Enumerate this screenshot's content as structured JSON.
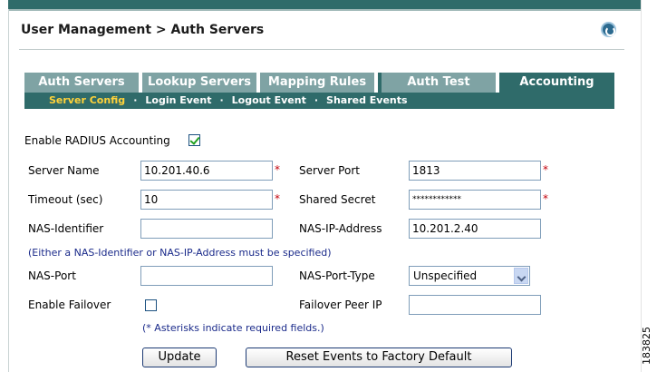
{
  "breadcrumb": "User Management > Auth Servers",
  "tabs": [
    {
      "label": "Auth Servers"
    },
    {
      "label": "Lookup Servers"
    },
    {
      "label": "Mapping Rules"
    },
    {
      "label": "Auth Test"
    },
    {
      "label": "Accounting"
    }
  ],
  "subtabs": [
    {
      "label": "Server Config"
    },
    {
      "label": "Login Event"
    },
    {
      "label": "Logout Event"
    },
    {
      "label": "Shared Events"
    }
  ],
  "form": {
    "enable_accounting_label": "Enable RADIUS Accounting",
    "enable_accounting_checked": true,
    "server_name_label": "Server Name",
    "server_name_value": "10.201.40.6",
    "server_port_label": "Server Port",
    "server_port_value": "1813",
    "timeout_label": "Timeout (sec)",
    "timeout_value": "10",
    "shared_secret_label": "Shared Secret",
    "shared_secret_value": "************",
    "nas_identifier_label": "NAS-Identifier",
    "nas_identifier_value": "",
    "nas_ip_label": "NAS-IP-Address",
    "nas_ip_value": "10.201.2.40",
    "nas_note": "(Either a NAS-Identifier or NAS-IP-Address must be specified)",
    "nas_port_label": "NAS-Port",
    "nas_port_value": "",
    "nas_port_type_label": "NAS-Port-Type",
    "nas_port_type_value": "Unspecified",
    "enable_failover_label": "Enable Failover",
    "enable_failover_checked": false,
    "failover_peer_label": "Failover Peer IP",
    "failover_peer_value": "",
    "required_marker": "*",
    "required_note": "(* Asterisks indicate required fields.)"
  },
  "buttons": {
    "update": "Update",
    "reset": "Reset Events to Factory Default"
  },
  "figure_number": "183825"
}
